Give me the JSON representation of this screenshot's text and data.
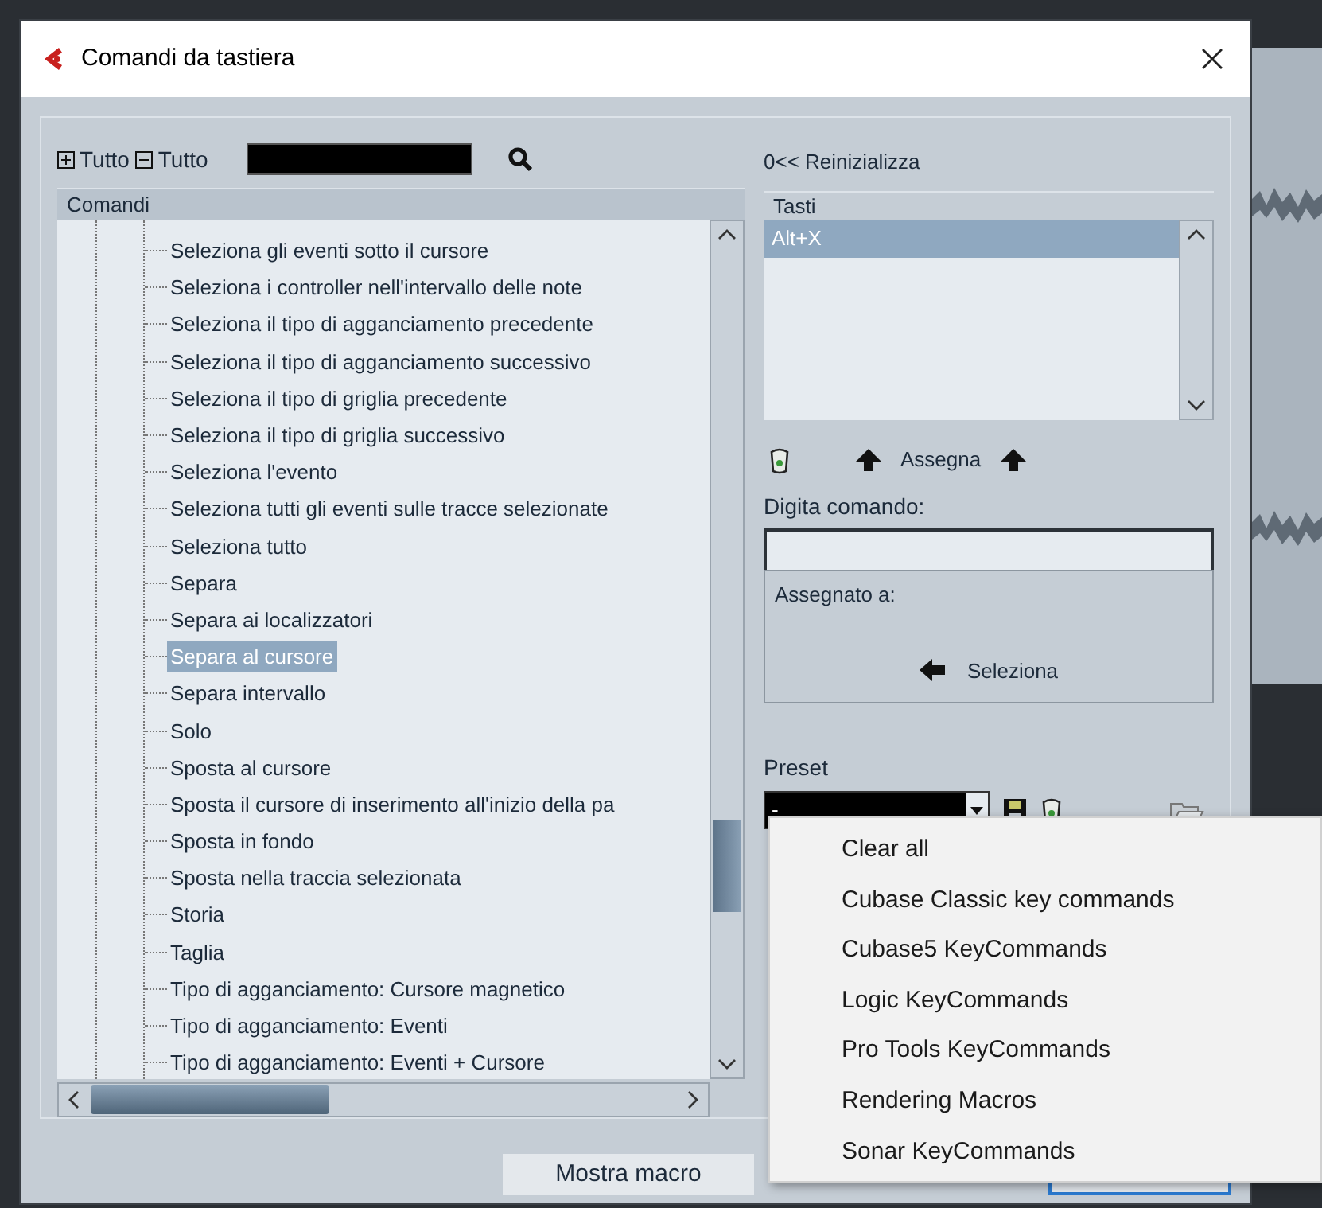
{
  "window": {
    "title": "Comandi da tastiera"
  },
  "toolbar": {
    "expand_all": "Tutto",
    "collapse_all": "Tutto"
  },
  "commands": {
    "column": "Comandi",
    "items": [
      {
        "label": "Seleziona gli eventi sotto il cursore",
        "selected": false
      },
      {
        "label": "Seleziona i controller nell'intervallo delle note",
        "selected": false
      },
      {
        "label": "Seleziona il tipo di agganciamento precedente",
        "selected": false
      },
      {
        "label": "Seleziona il tipo di agganciamento successivo",
        "selected": false
      },
      {
        "label": "Seleziona il tipo di griglia precedente",
        "selected": false
      },
      {
        "label": "Seleziona il tipo di griglia successivo",
        "selected": false
      },
      {
        "label": "Seleziona l'evento",
        "selected": false
      },
      {
        "label": "Seleziona tutti gli eventi sulle tracce selezionate",
        "selected": false
      },
      {
        "label": "Seleziona tutto",
        "selected": false
      },
      {
        "label": "Separa",
        "selected": false
      },
      {
        "label": "Separa ai localizzatori",
        "selected": false
      },
      {
        "label": "Separa al cursore",
        "selected": true
      },
      {
        "label": "Separa intervallo",
        "selected": false
      },
      {
        "label": "Solo",
        "selected": false
      },
      {
        "label": "Sposta al cursore",
        "selected": false
      },
      {
        "label": "Sposta il cursore di inserimento all'inizio della pa",
        "selected": false
      },
      {
        "label": "Sposta in fondo",
        "selected": false
      },
      {
        "label": "Sposta nella traccia selezionata",
        "selected": false
      },
      {
        "label": "Storia",
        "selected": false
      },
      {
        "label": "Taglia",
        "selected": false
      },
      {
        "label": "Tipo di agganciamento: Cursore magnetico",
        "selected": false
      },
      {
        "label": "Tipo di agganciamento: Eventi",
        "selected": false
      },
      {
        "label": "Tipo di agganciamento: Eventi + Cursore",
        "selected": false
      }
    ]
  },
  "reset": "0<< Reinizializza",
  "keys": {
    "column": "Tasti",
    "items": [
      {
        "label": "Alt+X",
        "selected": true
      }
    ]
  },
  "assign": "Assegna",
  "type_command": {
    "label": "Digita comando:"
  },
  "assigned_to": "Assegnato a:",
  "select": "Seleziona",
  "preset": {
    "label": "Preset",
    "value": "-"
  },
  "buttons": [
    "Mostra macro"
  ],
  "preset_menu": [
    "Clear all",
    "Cubase Classic key commands",
    "Cubase5 KeyCommands",
    "Logic KeyCommands",
    "Pro Tools KeyCommands",
    "Rendering Macros",
    "Sonar KeyCommands"
  ]
}
